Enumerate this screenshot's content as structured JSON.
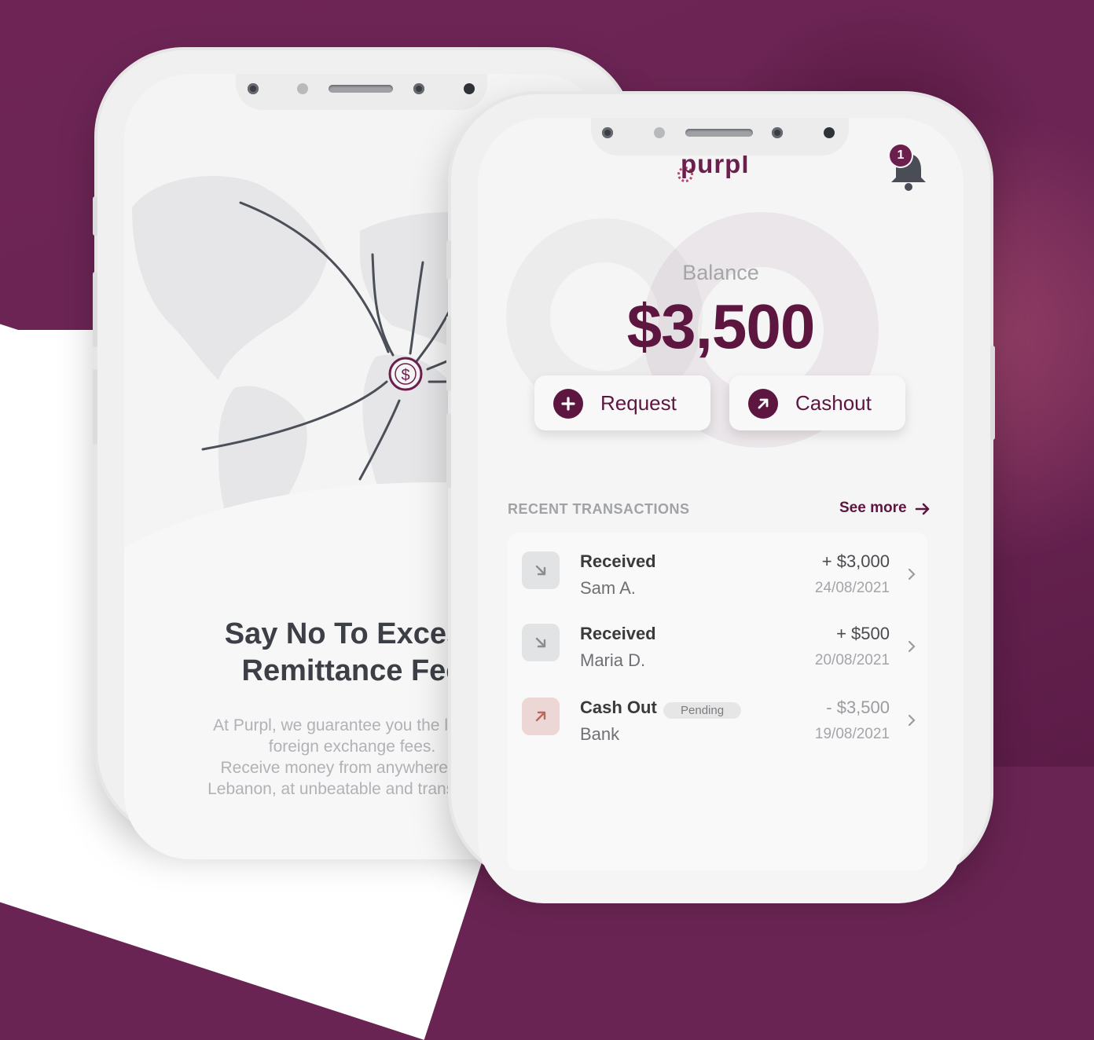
{
  "back_phone": {
    "title_line1": "Say No To Excess",
    "title_line2": "Remittance Fee",
    "body_lines": [
      "At Purpl, we guarantee you the lowest",
      "foreign exchange fees.",
      "Receive money from anywhere in th",
      "Lebanon, at unbeatable and transparen"
    ],
    "currency_symbol": "$"
  },
  "app": {
    "logo_text": "purpl",
    "notification_count": "1",
    "balance_label": "Balance",
    "balance_value": "$3,500",
    "request_label": "Request",
    "cashout_label": "Cashout",
    "recent_label": "RECENT TRANSACTIONS",
    "see_more_label": "See more",
    "transactions": [
      {
        "type": "Received",
        "party": "Sam A.",
        "amount": "+ $3,000",
        "date": "24/08/2021",
        "direction": "in",
        "badge": ""
      },
      {
        "type": "Received",
        "party": "Maria D.",
        "amount": "+ $500",
        "date": "20/08/2021",
        "direction": "in",
        "badge": ""
      },
      {
        "type": "Cash Out",
        "party": "Bank",
        "amount": "- $3,500",
        "date": "19/08/2021",
        "direction": "out",
        "badge": "Pending"
      }
    ]
  },
  "colors": {
    "brand": "#5d1640",
    "background": "#6a2453"
  }
}
